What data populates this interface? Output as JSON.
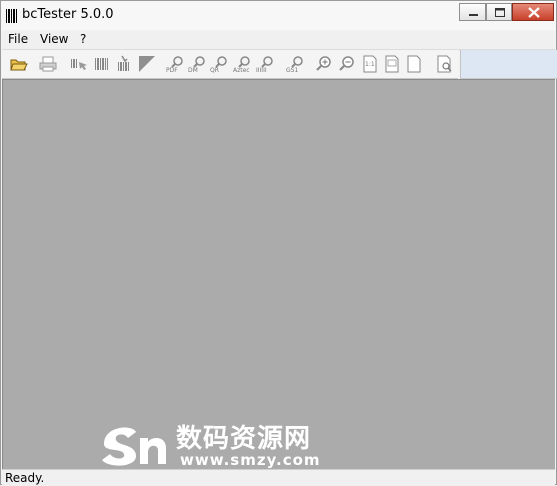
{
  "window": {
    "title": "bcTester 5.0.0"
  },
  "menu": {
    "items": [
      "File",
      "View",
      "?"
    ]
  },
  "toolbar": {
    "tools": [
      {
        "name": "open-folder-icon",
        "label": ""
      },
      {
        "name": "print-icon",
        "label": ""
      },
      {
        "name": "scan-icon",
        "label": ""
      },
      {
        "name": "barcode-icon",
        "label": ""
      },
      {
        "name": "scan-barcode-icon",
        "label": ""
      },
      {
        "name": "triangle-icon",
        "label": ""
      },
      {
        "name": "search-pdf-icon",
        "label": "PDF"
      },
      {
        "name": "search-dm-icon",
        "label": "DM"
      },
      {
        "name": "search-qr-icon",
        "label": "QR"
      },
      {
        "name": "search-aztec-icon",
        "label": "Aztec"
      },
      {
        "name": "search-linear-icon",
        "label": "IIIIII"
      },
      {
        "name": "search-gs1-icon",
        "label": "GS1"
      },
      {
        "name": "zoom-in-icon",
        "label": ""
      },
      {
        "name": "zoom-out-icon",
        "label": ""
      },
      {
        "name": "actual-size-icon",
        "label": "1:1"
      },
      {
        "name": "fit-page-icon",
        "label": ""
      },
      {
        "name": "blank-page-icon",
        "label": ""
      },
      {
        "name": "document-search-icon",
        "label": ""
      }
    ]
  },
  "watermark": {
    "title": "数码资源网",
    "url": "www.smzy.com"
  },
  "status": {
    "text": "Ready."
  }
}
